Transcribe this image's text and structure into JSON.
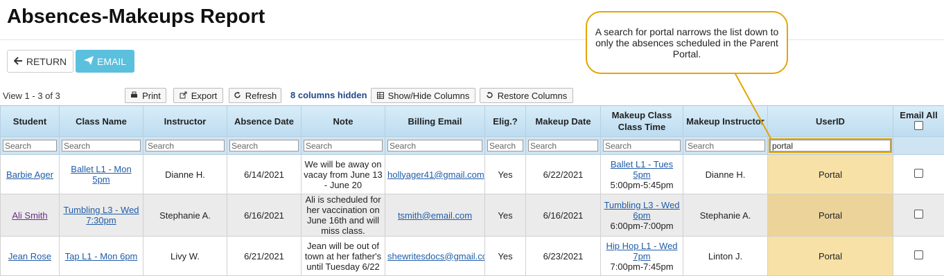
{
  "page": {
    "title": "Absences-Makeups Report"
  },
  "actions": {
    "return_label": "RETURN",
    "email_label": "EMAIL"
  },
  "toolbar": {
    "view_count": "View 1 - 3 of 3",
    "print": "Print",
    "export": "Export",
    "refresh": "Refresh",
    "hidden_columns": "8 columns hidden",
    "show_hide": "Show/Hide Columns",
    "restore": "Restore Columns"
  },
  "table": {
    "headers": [
      "Student",
      "Class Name",
      "Instructor",
      "Absence Date",
      "Note",
      "Billing Email",
      "Elig.?",
      "Makeup Date",
      "Makeup Class Class Time",
      "Makeup Instructor",
      "UserID",
      "Email All"
    ],
    "filter_placeholder": "Search",
    "userid_filter_value": "portal",
    "rows": [
      {
        "student": "Barbie Ager",
        "class_name": "Ballet L1 - Mon 5pm",
        "instructor": "Dianne H.",
        "absence_date": "6/14/2021",
        "note": "We will be away on vacay from June 13 - June 20",
        "billing_email": "hollyager41@gmail.com",
        "elig": "Yes",
        "makeup_date": "6/22/2021",
        "makeup_class": "Ballet L1 - Tues 5pm",
        "makeup_time": "5:00pm-5:45pm",
        "makeup_instructor": "Dianne H.",
        "userid": "Portal"
      },
      {
        "student": "Ali Smith",
        "class_name": "Tumbling L3 - Wed 7:30pm",
        "instructor": "Stephanie A.",
        "absence_date": "6/16/2021",
        "note": "Ali is scheduled for her vaccination on June 16th and will miss class.",
        "billing_email": "tsmith@email.com",
        "elig": "Yes",
        "makeup_date": "6/16/2021",
        "makeup_class": "Tumbling L3 - Wed 6pm",
        "makeup_time": "6:00pm-7:00pm",
        "makeup_instructor": "Stephanie A.",
        "userid": "Portal"
      },
      {
        "student": "Jean Rose",
        "class_name": "Tap L1 - Mon 6pm",
        "instructor": "Livy W.",
        "absence_date": "6/21/2021",
        "note": "Jean will be out of town at her father's until Tuesday 6/22",
        "billing_email": "shewritesdocs@gmail.com",
        "elig": "Yes",
        "makeup_date": "6/23/2021",
        "makeup_class": "Hip Hop L1 - Wed 7pm",
        "makeup_time": "7:00pm-7:45pm",
        "makeup_instructor": "Linton J.",
        "userid": "Portal"
      }
    ]
  },
  "callout": {
    "text": "A search for portal narrows the list down to only the absences scheduled in the Parent Portal."
  },
  "colors": {
    "accent": "#5bc0de",
    "highlight": "#f7e1a7",
    "callout_border": "#e4a500",
    "link": "#1f5ca8"
  }
}
